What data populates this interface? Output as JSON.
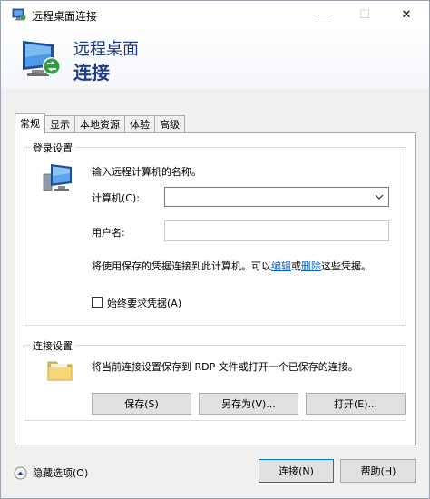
{
  "titlebar": {
    "title": "远程桌面连接",
    "minimize": "—",
    "maximize": "☐",
    "close": "✕"
  },
  "header": {
    "line1": "远程桌面",
    "line2": "连接"
  },
  "tabs": [
    {
      "label": "常规",
      "active": true
    },
    {
      "label": "显示",
      "active": false
    },
    {
      "label": "本地资源",
      "active": false
    },
    {
      "label": "体验",
      "active": false
    },
    {
      "label": "高级",
      "active": false
    }
  ],
  "login": {
    "legend": "登录设置",
    "instruction": "输入远程计算机的名称。",
    "computer_label": "计算机(C):",
    "computer_value": "",
    "username_label": "用户名:",
    "username_value": "",
    "saved_cred_prefix": "将使用保存的凭据连接到此计算机。可以",
    "edit_link": "编辑",
    "or_text": "或",
    "delete_link": "删除",
    "saved_cred_suffix": "这些凭据。",
    "always_ask_label": "始终要求凭据(A)"
  },
  "connection": {
    "legend": "连接设置",
    "description": "将当前连接设置保存到 RDP 文件或打开一个已保存的连接。",
    "save_label": "保存(S)",
    "saveas_label": "另存为(V)...",
    "open_label": "打开(E)..."
  },
  "footer": {
    "hide_options_label": "隐藏选项(O)",
    "connect_label": "连接(N)",
    "help_label": "帮助(H)"
  },
  "icons": {
    "app": "remote-desktop-icon",
    "computer": "computer-icon",
    "folder": "folder-icon",
    "collapse": "collapse-up-icon"
  },
  "colors": {
    "header_text": "#1e3a8a",
    "link": "#0066cc",
    "default_button_border": "#0078d7"
  }
}
